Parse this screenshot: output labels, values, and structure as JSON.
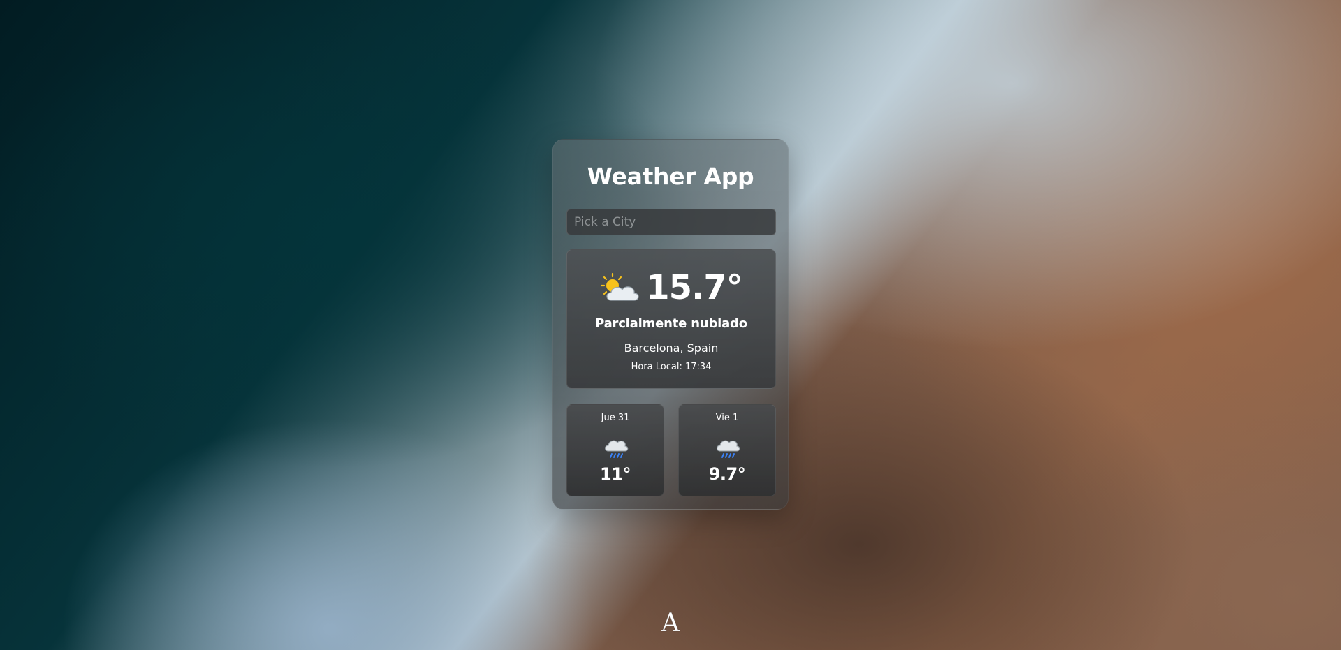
{
  "app": {
    "title": "Weather App"
  },
  "search": {
    "placeholder": "Pick a City",
    "value": ""
  },
  "current": {
    "icon": "partly-cloudy-icon",
    "temperature": "15.7°",
    "condition": "Parcialmente nublado",
    "location": "Barcelona, Spain",
    "local_time": "Hora Local: 17:34"
  },
  "forecast": [
    {
      "day": "Jue 31",
      "icon": "rain-cloud-icon",
      "temperature": "11°"
    },
    {
      "day": "Vie 1",
      "icon": "rain-cloud-icon",
      "temperature": "9.7°"
    }
  ],
  "footer": {
    "logo_letter": "A"
  },
  "colors": {
    "sun": "#f8c21c",
    "cloud": "#e9eef2",
    "rain": "#3b82f6",
    "text": "#ffffff",
    "placeholder": "#8d9193"
  }
}
